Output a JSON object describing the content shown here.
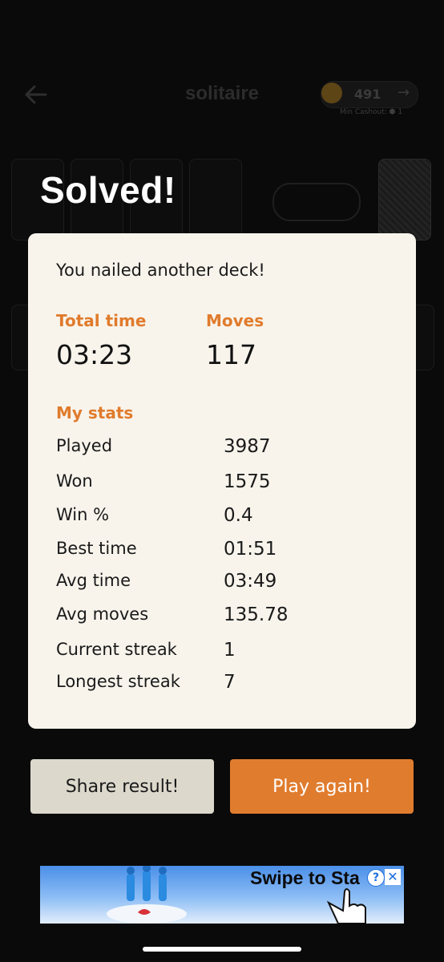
{
  "header": {
    "title": "solitaire",
    "coin_balance": "491",
    "min_cashout": "Min Cashout: ⬢ 1"
  },
  "result": {
    "title": "Solved!",
    "subtitle": "You nailed another deck!",
    "total_time_label": "Total time",
    "total_time_value": "03:23",
    "moves_label": "Moves",
    "moves_value": "117"
  },
  "my_stats": {
    "heading": "My stats",
    "rows": [
      {
        "label": "Played",
        "value": "3987"
      },
      {
        "label": "Won",
        "value": "1575"
      },
      {
        "label": "Win %",
        "value": "0.4"
      },
      {
        "label": "Best time",
        "value": "01:51"
      },
      {
        "label": "Avg time",
        "value": "03:49"
      },
      {
        "label": "Avg moves",
        "value": "135.78"
      },
      {
        "label": "Current streak",
        "value": "1"
      },
      {
        "label": "Longest streak",
        "value": "7"
      }
    ]
  },
  "buttons": {
    "share": "Share result!",
    "play_again": "Play again!"
  },
  "ad": {
    "text": "Swipe to Sta",
    "info_icon": "?",
    "close_icon": "✕"
  },
  "colors": {
    "accent_orange": "#e07c2e",
    "panel_bg": "#f8f4ec",
    "share_bg": "#dcd9cc"
  }
}
